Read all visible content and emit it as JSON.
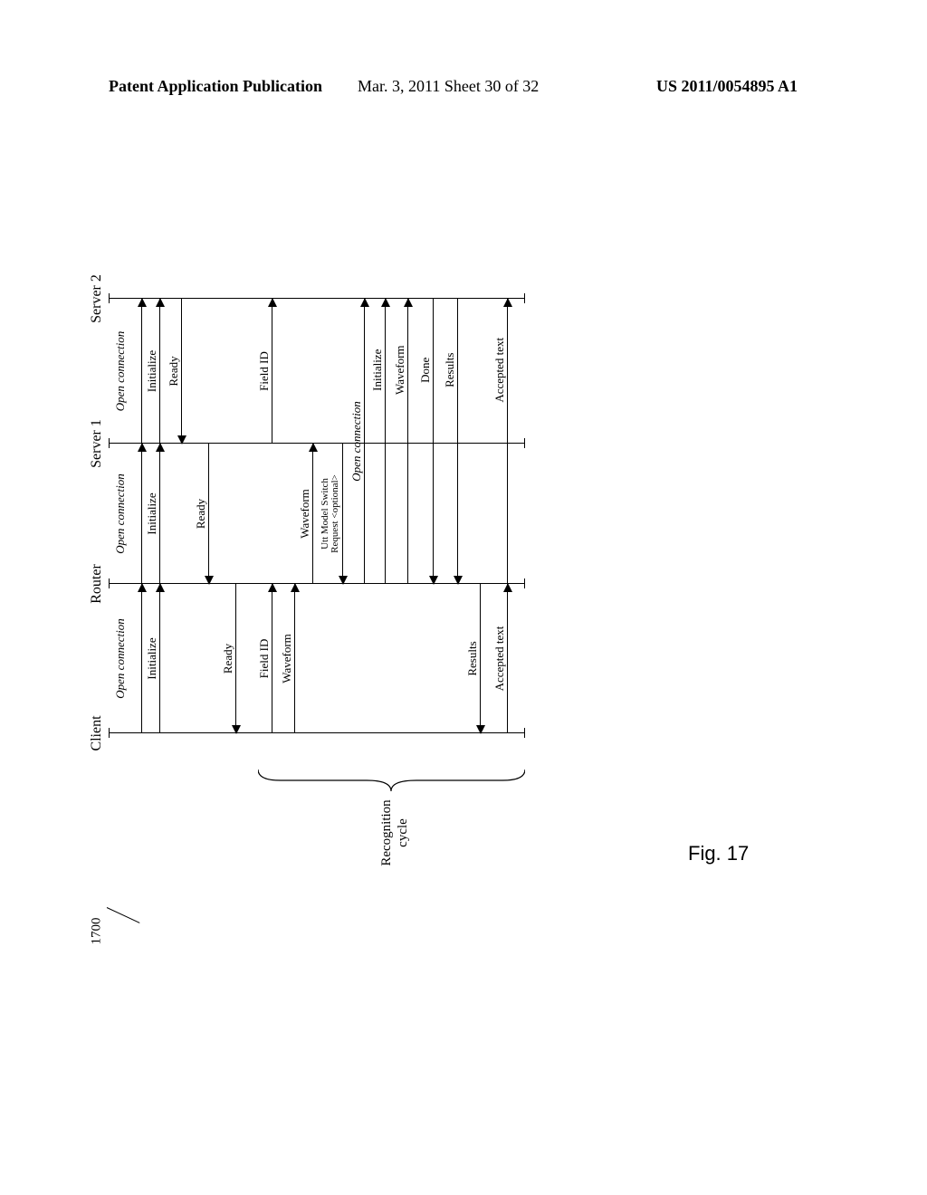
{
  "header": {
    "left": "Patent Application Publication",
    "center": "Mar. 3, 2011  Sheet 30 of 32",
    "right": "US 2011/0054895 A1"
  },
  "figure": {
    "ref_number": "1700",
    "caption": "Fig. 17",
    "actors": {
      "client": "Client",
      "router": "Router",
      "server1": "Server 1",
      "server2": "Server 2"
    },
    "brace_label_line1": "Recognition",
    "brace_label_line2": "cycle"
  },
  "messages": {
    "m01": "Open connection",
    "m02": "Initialize",
    "m03": "Open connection",
    "m04": "Initialize",
    "m05": "Open connection",
    "m06": "Initialize",
    "m07": "Ready",
    "m08": "Ready",
    "m09": "Ready",
    "m10": "Field ID",
    "m11": "Waveform",
    "m12": "Field ID",
    "m13": "Waveform",
    "m14a": "Utt Model Switch",
    "m14b": "Request <optional>",
    "m15": "Open connection",
    "m16": "Initialize",
    "m17": "Waveform",
    "m18": "Done",
    "m19": "Results",
    "m20": "Results",
    "m21": "Accepted text",
    "m22": "Accepted text"
  }
}
